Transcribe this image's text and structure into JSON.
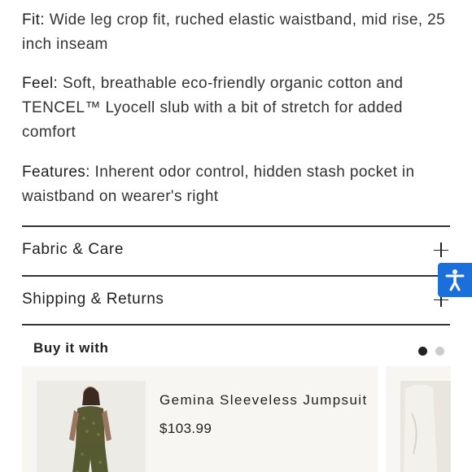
{
  "details": {
    "fit": {
      "label": "Fit:",
      "text": "Wide leg crop fit, ruched elastic waistband, mid rise, 25 inch inseam"
    },
    "feel": {
      "label": "Feel:",
      "text": "Soft, breathable eco-friendly organic cotton and TENCEL™ Lyocell slub with a bit of stretch for added comfort"
    },
    "features": {
      "label": "Features:",
      "text": "Inherent odor control, hidden stash pocket in waistband on wearer's right"
    }
  },
  "accordions": [
    {
      "title": "Fabric & Care"
    },
    {
      "title": "Shipping & Returns"
    }
  ],
  "buy_with": {
    "title": "Buy it with",
    "products": [
      {
        "name": "Gemina Sleeveless Jumpsuit",
        "price": "$103.99"
      }
    ],
    "pagination": {
      "count": 2,
      "active_index": 0
    }
  },
  "icons": {
    "accessibility": "accessibility-icon",
    "expand": "plus-icon"
  },
  "colors": {
    "accessibility_button": "#1a6fdb",
    "card_background": "#f7f6f2"
  }
}
